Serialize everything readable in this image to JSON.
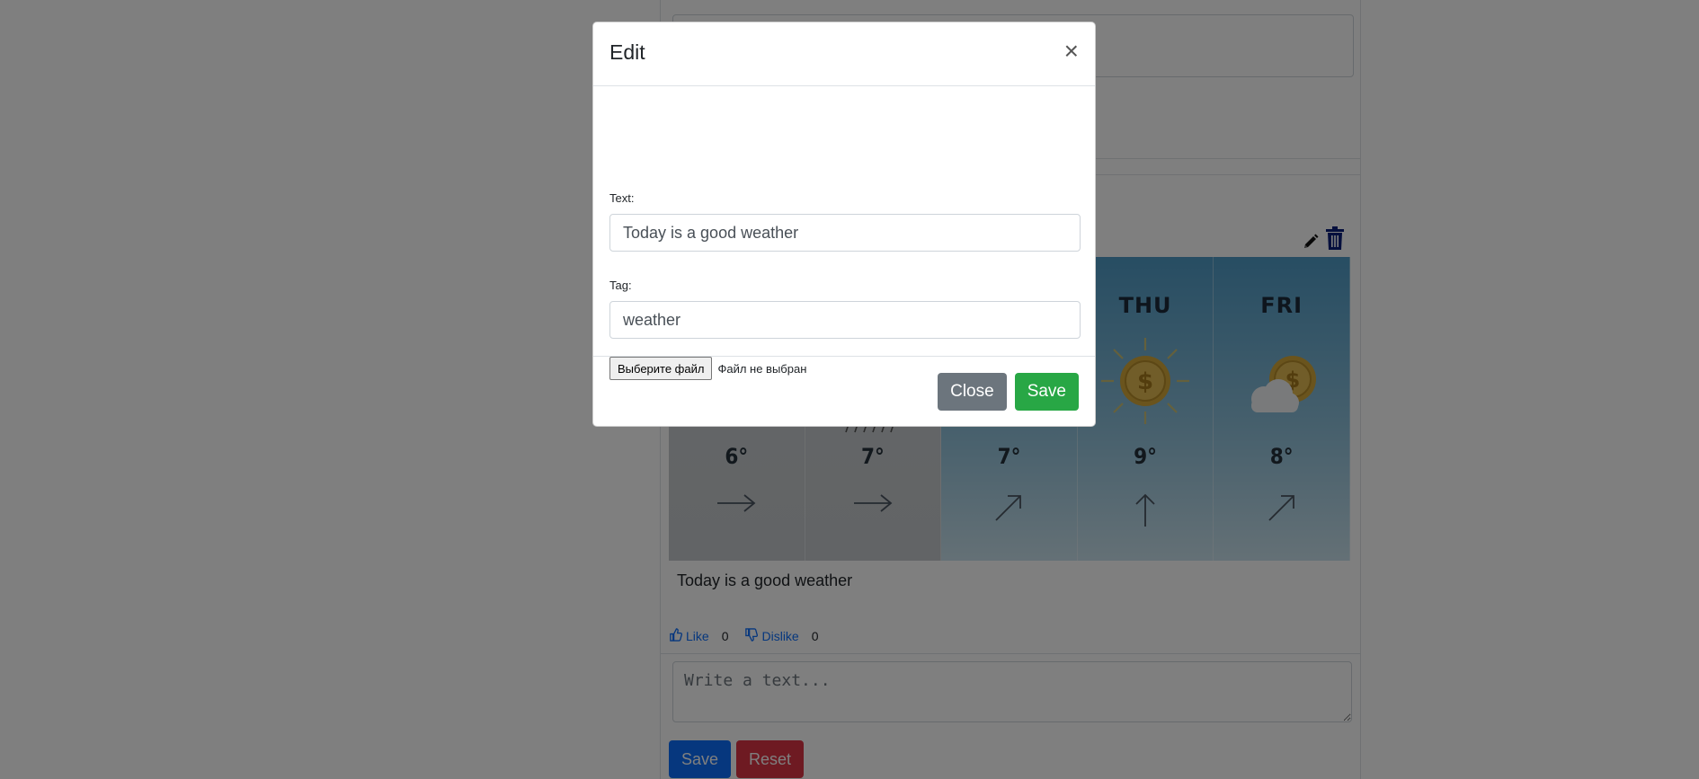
{
  "background": {
    "post": {
      "forecast": [
        {
          "day": "",
          "temp": "6°",
          "wind": "east-arrow",
          "style": "grey"
        },
        {
          "day": "",
          "temp": "7°",
          "wind": "east-arrow",
          "style": "grey"
        },
        {
          "day": "",
          "temp": "7°",
          "wind": "northeast-arrow",
          "style": "blue"
        },
        {
          "day": "THU",
          "temp": "9°",
          "wind": "north-arrow",
          "style": "blue",
          "icon": "sun-coin-icon"
        },
        {
          "day": "FRI",
          "temp": "8°",
          "wind": "northeast-arrow",
          "style": "blue",
          "icon": "cloud-coin-icon"
        }
      ],
      "text": "Today is a good weather",
      "like_label": "Like",
      "like_count": "0",
      "dislike_label": "Dislike",
      "dislike_count": "0"
    },
    "comment": {
      "placeholder": "Write a text...",
      "save_label": "Save",
      "reset_label": "Reset"
    },
    "colors": {
      "primary": "#0d6efd",
      "danger": "#dc3545",
      "secondary": "#6c757d",
      "success": "#28a745",
      "trash": "#0b1f7a"
    }
  },
  "modal": {
    "title": "Edit",
    "close_symbol": "×",
    "text_label": "Text:",
    "text_value": "Today is a good weather",
    "tag_label": "Tag:",
    "tag_value": "weather",
    "file_button_label": "Выберите файл",
    "file_status": "Файл не выбран",
    "close_button_label": "Close",
    "save_button_label": "Save"
  }
}
